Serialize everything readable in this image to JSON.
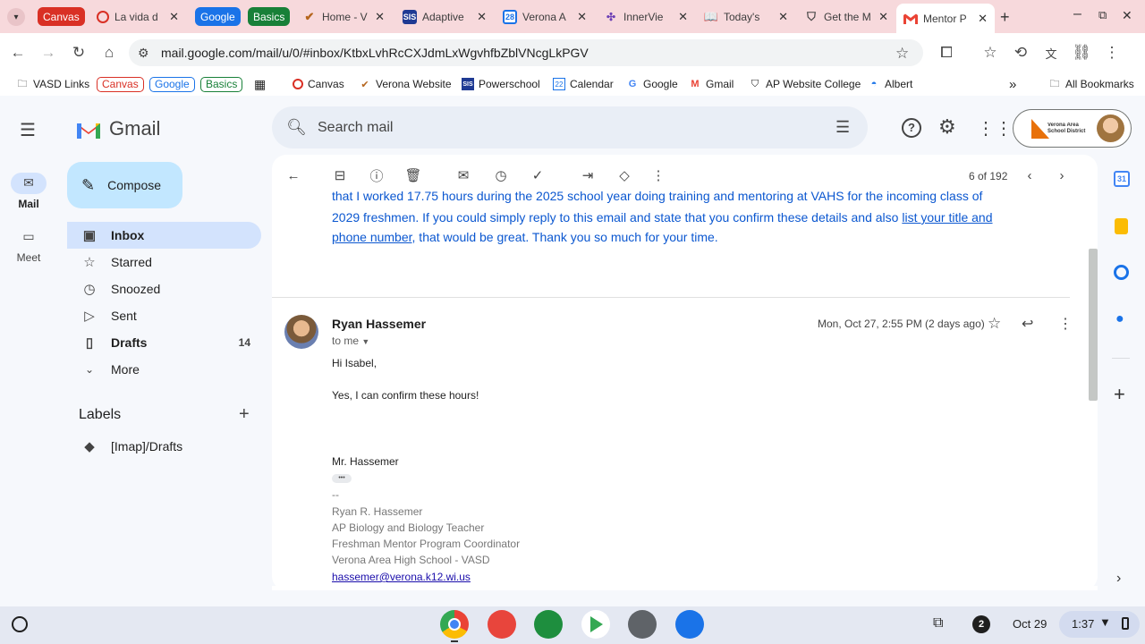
{
  "browser": {
    "tabs": [
      {
        "kind": "group",
        "label": "Canvas",
        "color": "#d93025"
      },
      {
        "kind": "tab",
        "title": "La vida d",
        "icon": "canvas-ring"
      },
      {
        "kind": "group",
        "label": "Google",
        "color": "#1a73e8"
      },
      {
        "kind": "group",
        "label": "Basics",
        "color": "#188038"
      },
      {
        "kind": "tab",
        "title": "Home - V",
        "icon": "verona-v"
      },
      {
        "kind": "tab",
        "title": "Adaptive",
        "icon": "sis"
      },
      {
        "kind": "tab",
        "title": "Verona A",
        "icon": "calendar"
      },
      {
        "kind": "tab",
        "title": "InnerVie",
        "icon": "innerview"
      },
      {
        "kind": "tab",
        "title": "Today's",
        "icon": "book"
      },
      {
        "kind": "tab",
        "title": "Get the M",
        "icon": "shield"
      },
      {
        "kind": "tab",
        "title": "Mentor P",
        "icon": "gmail",
        "active": true
      }
    ],
    "url": "mail.google.com/mail/u/0/#inbox/KtbxLvhRcCXJdmLxWgvhfbZblVNcgLkPGV",
    "bookmarks": {
      "vasd_links": "VASD Links",
      "canvas_chip": "Canvas",
      "google_chip": "Google",
      "basics_chip": "Basics",
      "canvas": "Canvas",
      "verona_website": "Verona Website",
      "powerschool": "Powerschool",
      "calendar": "Calendar",
      "google": "Google",
      "gmail": "Gmail",
      "ap_website": "AP Website College",
      "albert": "Albert",
      "overflow": "»",
      "all_bookmarks": "All Bookmarks"
    }
  },
  "gmail": {
    "brand": "Gmail",
    "search_placeholder": "Search mail",
    "account_org": "Verona Area School District",
    "rail": {
      "mail": "Mail",
      "meet": "Meet"
    },
    "compose": "Compose",
    "nav": [
      {
        "label": "Inbox",
        "icon": "inbox-icon",
        "count": "",
        "active": true,
        "bold": true
      },
      {
        "label": "Starred",
        "icon": "star-icon",
        "count": "",
        "bold": false
      },
      {
        "label": "Snoozed",
        "icon": "clock-icon",
        "count": "",
        "bold": false
      },
      {
        "label": "Sent",
        "icon": "send-icon",
        "count": "",
        "bold": false
      },
      {
        "label": "Drafts",
        "icon": "draft-icon",
        "count": "14",
        "bold": true
      },
      {
        "label": "More",
        "icon": "chevron-down-icon",
        "count": "",
        "bold": false
      }
    ],
    "labels_heading": "Labels",
    "labels": [
      "[Imap]/Drafts"
    ],
    "pager": "6 of 192",
    "prev_message": {
      "line1": "that I worked 17.75 hours during the 2025 school year doing training and mentoring at VAHS for the incoming class of",
      "line2": "2029 freshmen. If you could simply reply to this email and state that you confirm these details and also ",
      "link": "list your title and",
      "line3_link": "phone number",
      "line3_rest": ", that would be great. Thank you so much for your time."
    },
    "message": {
      "sender": "Ryan Hassemer",
      "to": "to me",
      "date": "Mon, Oct 27, 2:55 PM (2 days ago)",
      "greeting": "Hi Isabel,",
      "body": "Yes, I can confirm these hours!",
      "signoff": "Mr. Hassemer",
      "ellipsis": "•••",
      "sig_dash": "--",
      "sig": [
        "Ryan R. Hassemer",
        "AP Biology and Biology Teacher",
        "Freshman Mentor Program Coordinator",
        "Verona Area High School - VASD"
      ],
      "email": "hassemer@verona.k12.wi.us"
    }
  },
  "shelf": {
    "notification_count": "2",
    "date": "Oct 29",
    "time": "1:37"
  },
  "colors": {
    "gmail_red": "#ea4335",
    "compose_bg": "#c2e7ff",
    "inbox_active": "#d3e3fd",
    "link": "#1a0dab",
    "tab_strip": "#f7d9dc"
  }
}
